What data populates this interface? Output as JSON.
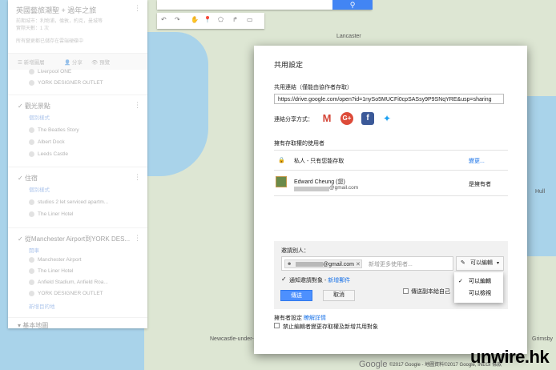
{
  "map": {
    "cities": [
      "Lancaster",
      "Newcastle-under-Lyme",
      "Hull",
      "Grimsby"
    ],
    "google_logo": "Google",
    "copyright": "©2017 Google - 地圖資料©2017 Google, INEGI 條款",
    "watermark": "unwire.hk"
  },
  "left_panel": {
    "title": "英國藝旅潮聖 + 過年之旅",
    "lines": [
      "前期城市：利物浦，倫敦，約克，曼城等",
      "實際天數：1 次",
      "所有變更都已儲存在雲端硬碟中"
    ],
    "actions": {
      "add_layer": "新增圖層",
      "share": "分享",
      "preview": "預覽"
    },
    "top_places": [
      "Liverpool ONE",
      "YORK DESIGNER OUTLET"
    ],
    "layers": [
      {
        "name": "觀光景點",
        "style": "個別樣式",
        "places": [
          "The Beatles Story",
          "Albert Dock",
          "Leeds Castle"
        ]
      },
      {
        "name": "住宿",
        "style": "個別樣式",
        "places": [
          "studios 2 let serviced apartm...",
          "The Liner Hotel"
        ]
      },
      {
        "name": "從Manchester Airport到YORK DES...",
        "style": "開車",
        "places": [
          "Manchester Airport",
          "The Liner Hotel",
          "Anfield Stadium, Anfield Roa...",
          "YORK DESIGNER OUTLET"
        ],
        "add_destination": "新增目的地"
      }
    ],
    "base_map": "基本地圖"
  },
  "toolbar": {
    "tools": [
      "↶",
      "↷",
      "✋",
      "📍",
      "⬠",
      "↱",
      "▭"
    ]
  },
  "dialog": {
    "title": "共用設定",
    "link_label": "共用連結（僅能由協作者存取）",
    "link_value": "https://drive.google.com/open?id=1nySo5MUCFi0cpSASsy9P9SNqYRE&usp=sharing",
    "share_via_label": "連結分享方式：",
    "share_icons": [
      {
        "name": "gmail-icon",
        "glyph": "M",
        "color": "#ffffff"
      },
      {
        "name": "google-plus-icon",
        "glyph": "G+",
        "color": "#dd4b39"
      },
      {
        "name": "facebook-icon",
        "glyph": "f",
        "color": "#3b5998"
      },
      {
        "name": "twitter-icon",
        "glyph": "🐦",
        "color": "#1da1f2"
      }
    ],
    "access_header": "擁有存取權的使用者",
    "private_label": "私人 - 只有您能存取",
    "change_link": "變更...",
    "owner_name": "Edward Cheung (您)",
    "owner_email": "@gmail.com",
    "owner_role": "是擁有者",
    "invite_label": "邀請別人：",
    "chip_email": "@gmail.com",
    "invite_placeholder": "新增更多使用者...",
    "permission_value": "可以編輯",
    "permission_options": [
      "可以編輯",
      "可以檢視"
    ],
    "notify_label": "通知邀請對象 -",
    "add_message_link": "新增郵件",
    "send_copy_label": "傳送副本給自己",
    "send_label": "傳送",
    "cancel_label": "取消",
    "owner_settings_label": "擁有者設定",
    "learn_more_link": "瞭解詳情",
    "prevent_label": "禁止編輯者變更存取權及新增共用對象"
  }
}
